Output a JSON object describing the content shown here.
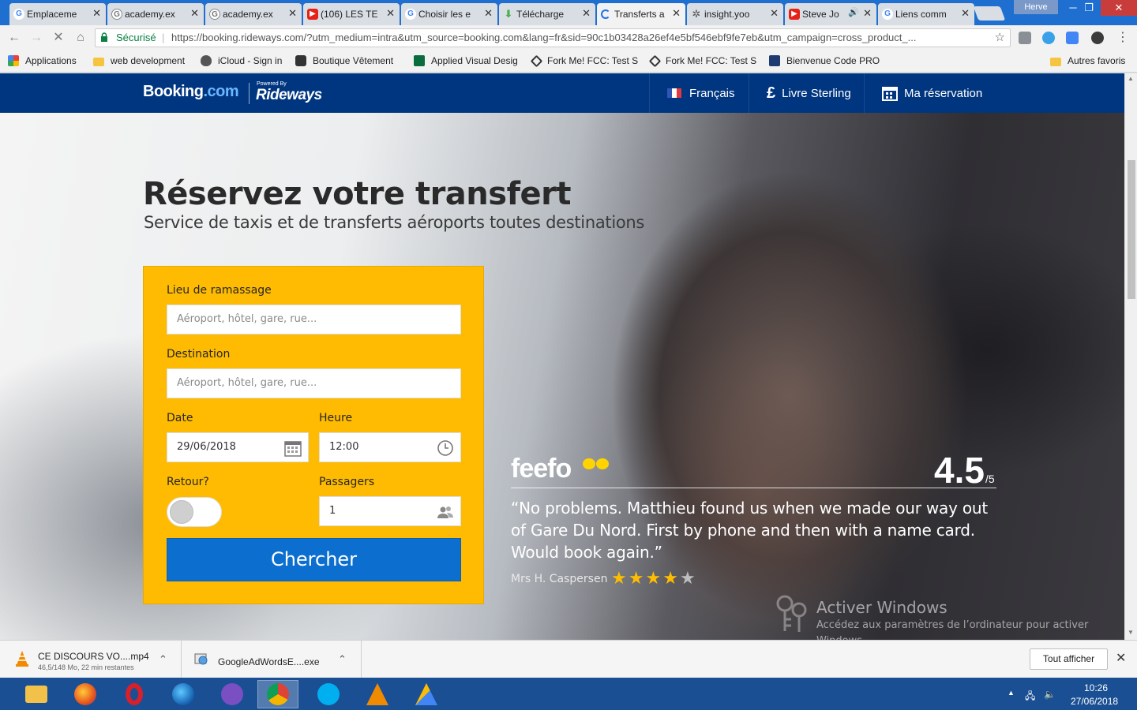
{
  "browser": {
    "tabs": [
      {
        "title": "Emplaceme",
        "icon": "google-icon"
      },
      {
        "title": "academy.ex",
        "icon": "google-icon"
      },
      {
        "title": "academy.ex",
        "icon": "google-icon"
      },
      {
        "title": "(106) LES TE",
        "icon": "youtube-icon"
      },
      {
        "title": "Choisir les e",
        "icon": "google-icon"
      },
      {
        "title": "Télécharge",
        "icon": "download-icon"
      },
      {
        "title": "Transferts a",
        "icon": "loading-icon"
      },
      {
        "title": "insight.yoo",
        "icon": "gear-icon"
      },
      {
        "title": "Steve Jo",
        "icon": "youtube-icon"
      },
      {
        "title": "Liens comm",
        "icon": "google-icon"
      }
    ],
    "profile": "Herve",
    "secure_label": "Sécurisé",
    "url": "https://booking.rideways.com/?utm_medium=intra&utm_source=booking.com&lang=fr&sid=90c1b03428a26ef4e5bf546ebf9fe7eb&utm_campaign=cross_product_...",
    "bookmarks": [
      {
        "label": "Applications",
        "icon": "apps-grid-icon"
      },
      {
        "label": "web development",
        "icon": "folder-icon"
      },
      {
        "label": "iCloud - Sign in",
        "icon": "apple-icon"
      },
      {
        "label": "Boutique Vêtement",
        "icon": "camera-icon"
      },
      {
        "label": "Applied Visual Desig",
        "icon": "fcc-icon"
      },
      {
        "label": "Fork Me! FCC: Test S",
        "icon": "codepen-icon"
      },
      {
        "label": "Fork Me! FCC: Test S",
        "icon": "codepen-icon"
      },
      {
        "label": "Bienvenue Code PRO",
        "icon": "codepro-icon"
      }
    ],
    "other_bookmarks": "Autres favoris"
  },
  "site": {
    "logo_booking": "Booking",
    "logo_com": ".com",
    "powered_by": "Powered By",
    "logo_rideways": "Rideways",
    "nav": {
      "language": "Français",
      "currency": "Livre Sterling",
      "reservation": "Ma réservation"
    }
  },
  "hero": {
    "title": "Réservez votre transfert",
    "subtitle": "Service de taxis et de transferts aéroports toutes destinations"
  },
  "form": {
    "pickup_label": "Lieu de ramassage",
    "pickup_placeholder": "Aéroport, hôtel, gare, rue...",
    "destination_label": "Destination",
    "destination_placeholder": "Aéroport, hôtel, gare, rue...",
    "date_label": "Date",
    "date_value": "29/06/2018",
    "time_label": "Heure",
    "time_value": "12:00",
    "return_label": "Retour?",
    "return_enabled": false,
    "passengers_label": "Passagers",
    "passengers_value": "1",
    "search_label": "Chercher"
  },
  "review": {
    "brand": "feefo",
    "rating": "4.5",
    "rating_max": "/5",
    "quote": "“No problems. Matthieu found us when we made our way out of Gare Du Nord. First by phone and then with a name card. Would book again.”",
    "author": "Mrs H. Caspersen",
    "stars": 4,
    "stars_total": 5
  },
  "windows_watermark": {
    "title": "Activer Windows",
    "subtitle": "Accédez aux paramètres de l’ordinateur pour activer Windows."
  },
  "downloads": [
    {
      "name": "CE DISCOURS VO....mp4",
      "status": "46,5/148 Mo, 22 min restantes",
      "icon": "vlc-icon"
    },
    {
      "name": "GoogleAdWordsE....exe",
      "status": "",
      "icon": "installer-icon"
    }
  ],
  "downloads_show_all": "Tout afficher",
  "taskbar": {
    "time": "10:26",
    "date": "27/06/2018"
  },
  "colors": {
    "booking_blue": "#003580",
    "form_yellow": "#febb02",
    "button_blue": "#0c6fcf",
    "star_gold": "#ffbd00"
  }
}
